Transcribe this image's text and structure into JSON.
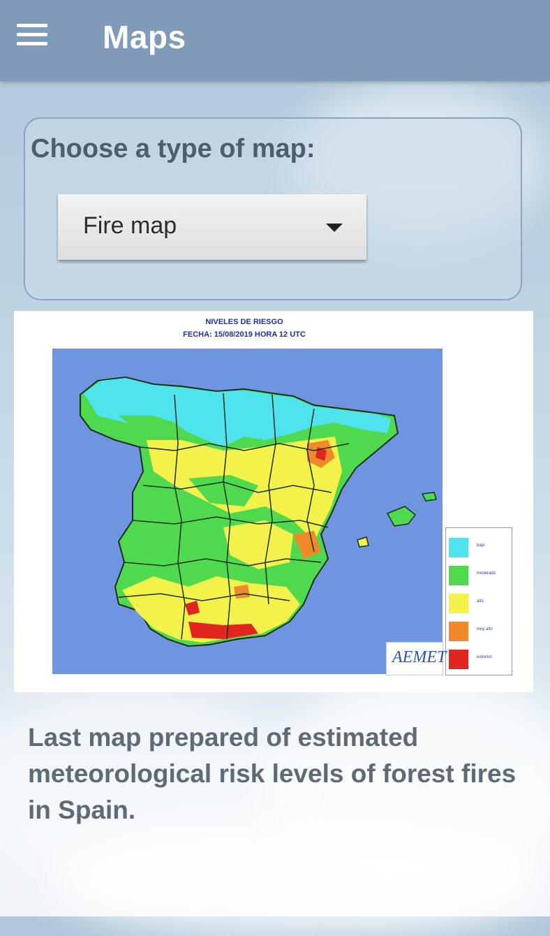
{
  "app_bar": {
    "title": "Maps",
    "menu_icon": "hamburger-menu-icon"
  },
  "selector": {
    "label": "Choose a type of map:",
    "selected": "Fire map",
    "caret_icon": "dropdown-caret-icon"
  },
  "map": {
    "title_line1": "NIVELES DE RIESGO",
    "title_line2": "FECHA: 15/08/2019 HORA 12 UTC",
    "logo_text": "AEMET",
    "legend": [
      {
        "label": "bajo",
        "color": "#4fe3ee"
      },
      {
        "label": "moderado",
        "color": "#4fd94f"
      },
      {
        "label": "alto",
        "color": "#f2f24a"
      },
      {
        "label": "muy alto",
        "color": "#ee8a2a"
      },
      {
        "label": "extremo",
        "color": "#e0261f"
      }
    ],
    "sea_color": "#6f94e0"
  },
  "caption": "Last map prepared of estimated meteorological risk levels of forest fires in Spain."
}
